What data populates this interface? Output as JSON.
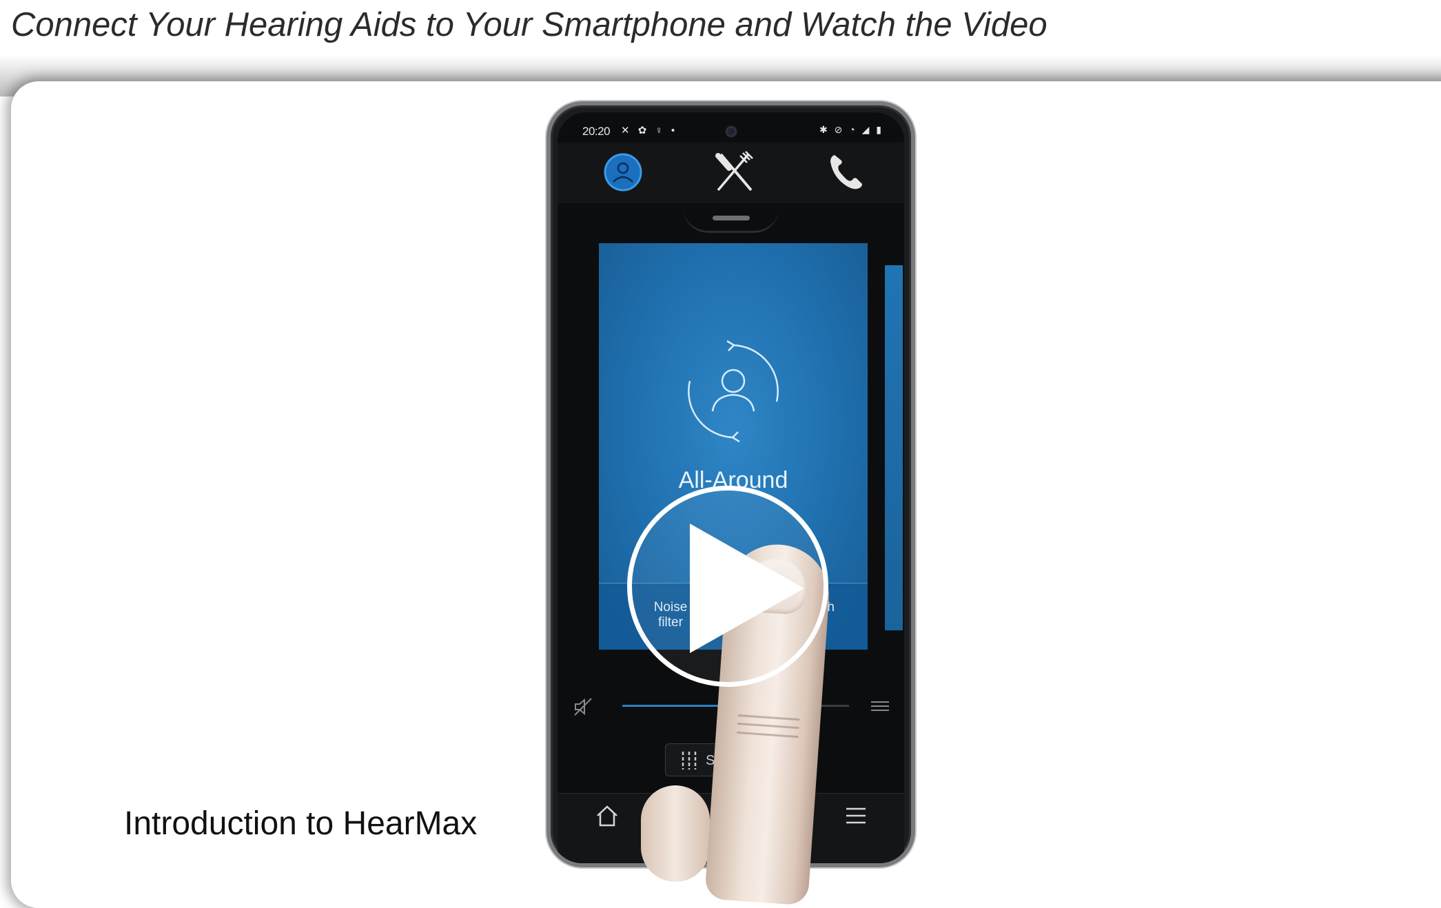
{
  "page": {
    "title": "Connect Your Hearing Aids to Your Smartphone and Watch the Video"
  },
  "video": {
    "caption": "Introduction to HearMax",
    "play_icon": "play-icon"
  },
  "phone": {
    "status_time": "20:20",
    "status_left_icons": "✕ ✿ ♀ •",
    "status_right_icons": "✱ ⊘ ◔ ◢ ▮",
    "programs": [
      {
        "icon": "person-circle-icon",
        "active": true
      },
      {
        "icon": "fork-knife-icon",
        "active": false
      },
      {
        "icon": "phone-icon",
        "active": false
      }
    ],
    "current_program": "All-Around",
    "noise_filter_label": "Noise\nfilter",
    "speech_label": "ch",
    "volume_level": 0.5,
    "sound_button_label": "Sou",
    "accent_color": "#1f6fae"
  }
}
